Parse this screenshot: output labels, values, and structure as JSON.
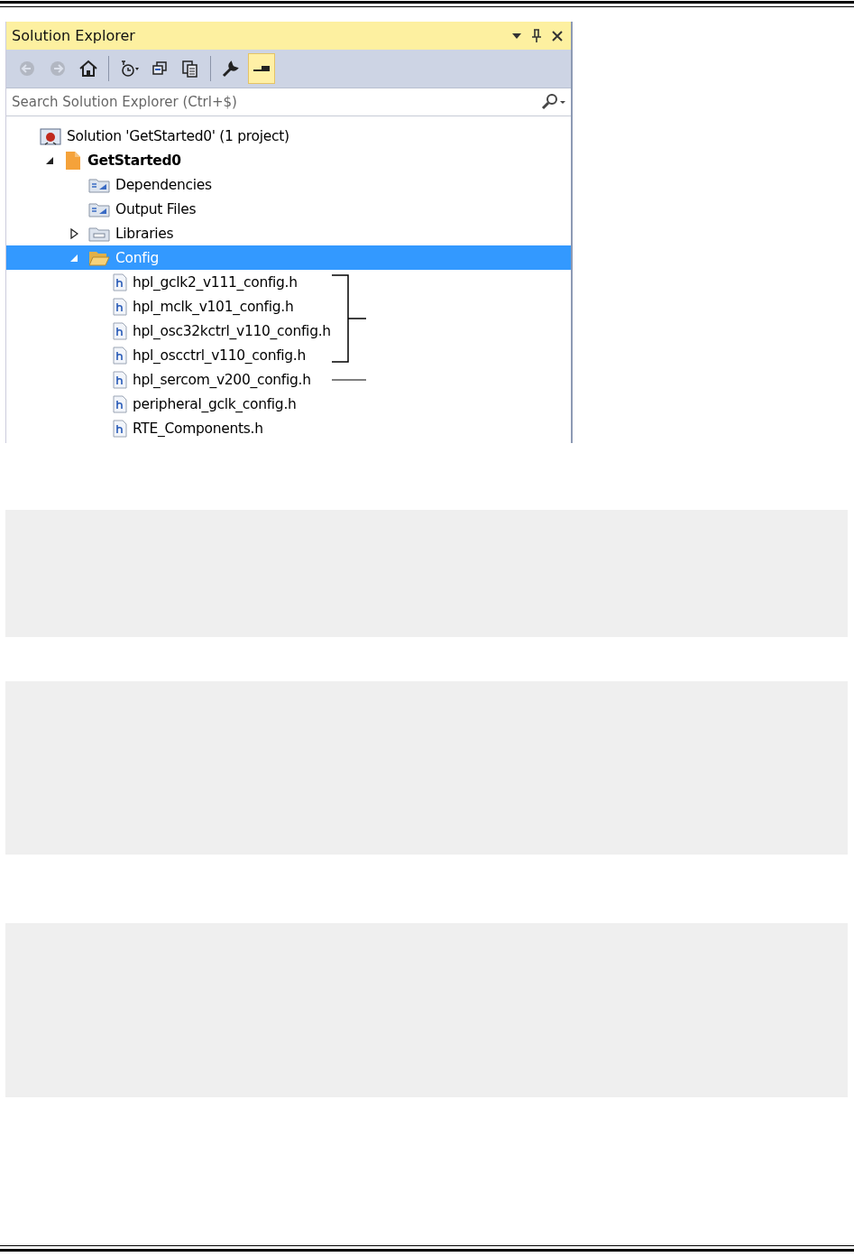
{
  "panel": {
    "title": "Solution Explorer",
    "search": {
      "placeholder": "Search Solution Explorer (Ctrl+$)"
    },
    "toolbar": [
      {
        "kind": "back",
        "disabled": true,
        "selected": false
      },
      {
        "kind": "forward",
        "disabled": true,
        "selected": false
      },
      {
        "kind": "home",
        "disabled": false,
        "selected": false
      },
      {
        "kind": "history",
        "disabled": false,
        "selected": false
      },
      {
        "kind": "collapse",
        "disabled": false,
        "selected": false
      },
      {
        "kind": "copy",
        "disabled": false,
        "selected": false
      },
      {
        "kind": "properties",
        "disabled": false,
        "selected": false
      },
      {
        "kind": "preview",
        "disabled": false,
        "selected": true
      }
    ],
    "tree": [
      {
        "label": "Solution 'GetStarted0' (1 project)",
        "kind": "solution",
        "selected": false,
        "children": [
          {
            "label": "GetStarted0",
            "kind": "project",
            "expanded": true,
            "selected": false,
            "children": [
              {
                "label": "Dependencies",
                "kind": "reference",
                "selected": false
              },
              {
                "label": "Output Files",
                "kind": "reference",
                "selected": false
              },
              {
                "label": "Libraries",
                "kind": "library",
                "expanded": false,
                "selected": false
              },
              {
                "label": "Config",
                "kind": "folder",
                "expanded": true,
                "selected": true,
                "children": [
                  {
                    "label": "hpl_gclk2_v111_config.h",
                    "kind": "header",
                    "selected": false,
                    "bracketed": true
                  },
                  {
                    "label": "hpl_mclk_v101_config.h",
                    "kind": "header",
                    "selected": false,
                    "bracketed": true
                  },
                  {
                    "label": "hpl_osc32kctrl_v110_config.h",
                    "kind": "header",
                    "selected": false,
                    "bracketed": true
                  },
                  {
                    "label": "hpl_oscctrl_v110_config.h",
                    "kind": "header",
                    "selected": false,
                    "bracketed": true
                  },
                  {
                    "label": "hpl_sercom_v200_config.h",
                    "kind": "header",
                    "selected": false,
                    "leader_line": true
                  },
                  {
                    "label": "peripheral_gclk_config.h",
                    "kind": "header",
                    "selected": false
                  },
                  {
                    "label": "RTE_Components.h",
                    "kind": "header",
                    "selected": false
                  }
                ]
              }
            ]
          }
        ]
      }
    ]
  },
  "blocks": [
    {
      "kind": "code"
    },
    {
      "kind": "code"
    },
    {
      "kind": "code"
    }
  ]
}
